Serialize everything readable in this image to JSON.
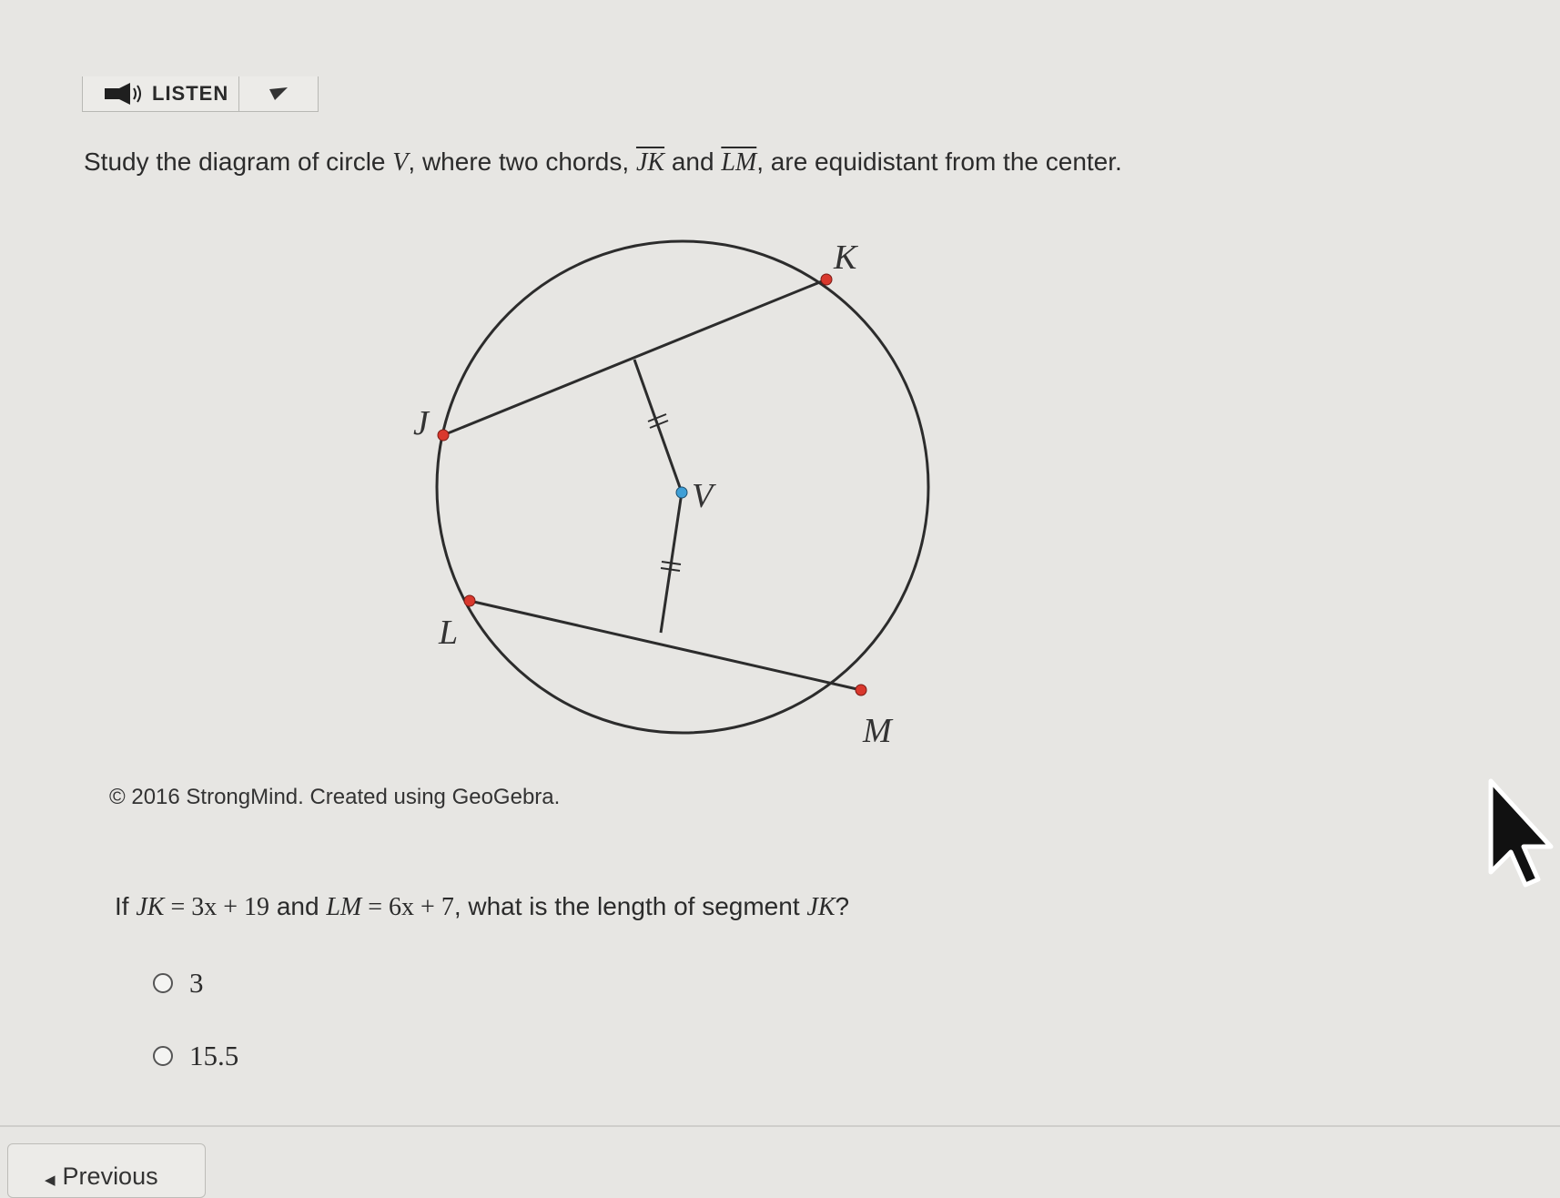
{
  "toolbar": {
    "listen_label": "LISTEN",
    "speaker_icon": "speaker-icon",
    "options_icon": "triangle-menu-icon"
  },
  "question": {
    "intro_part1": "Study the diagram of circle ",
    "circle_name": "V",
    "intro_part2": ", where two chords, ",
    "chord1": "JK",
    "intro_and": " and ",
    "chord2": "LM",
    "intro_part3": ", are equidistant from the center."
  },
  "diagram": {
    "labels": {
      "J": "J",
      "K": "K",
      "L": "L",
      "M": "M",
      "V": "V"
    },
    "point_color": "#d9382d",
    "center_color": "#3f9fd6",
    "stroke_color": "#2c2c2c"
  },
  "copyright": "© 2016 StrongMind. Created using GeoGebra.",
  "prompt": {
    "prefix": "If ",
    "jk": "JK",
    "eq1": " = 3x + 19",
    "and": " and ",
    "lm": "LM",
    "eq2": " = 6x + 7",
    "suffix": ", what is the length of segment ",
    "target": "JK",
    "qmark": "?"
  },
  "choices": [
    {
      "label": "3"
    },
    {
      "label": "15.5"
    }
  ],
  "navigation": {
    "previous_label": "Previous"
  }
}
